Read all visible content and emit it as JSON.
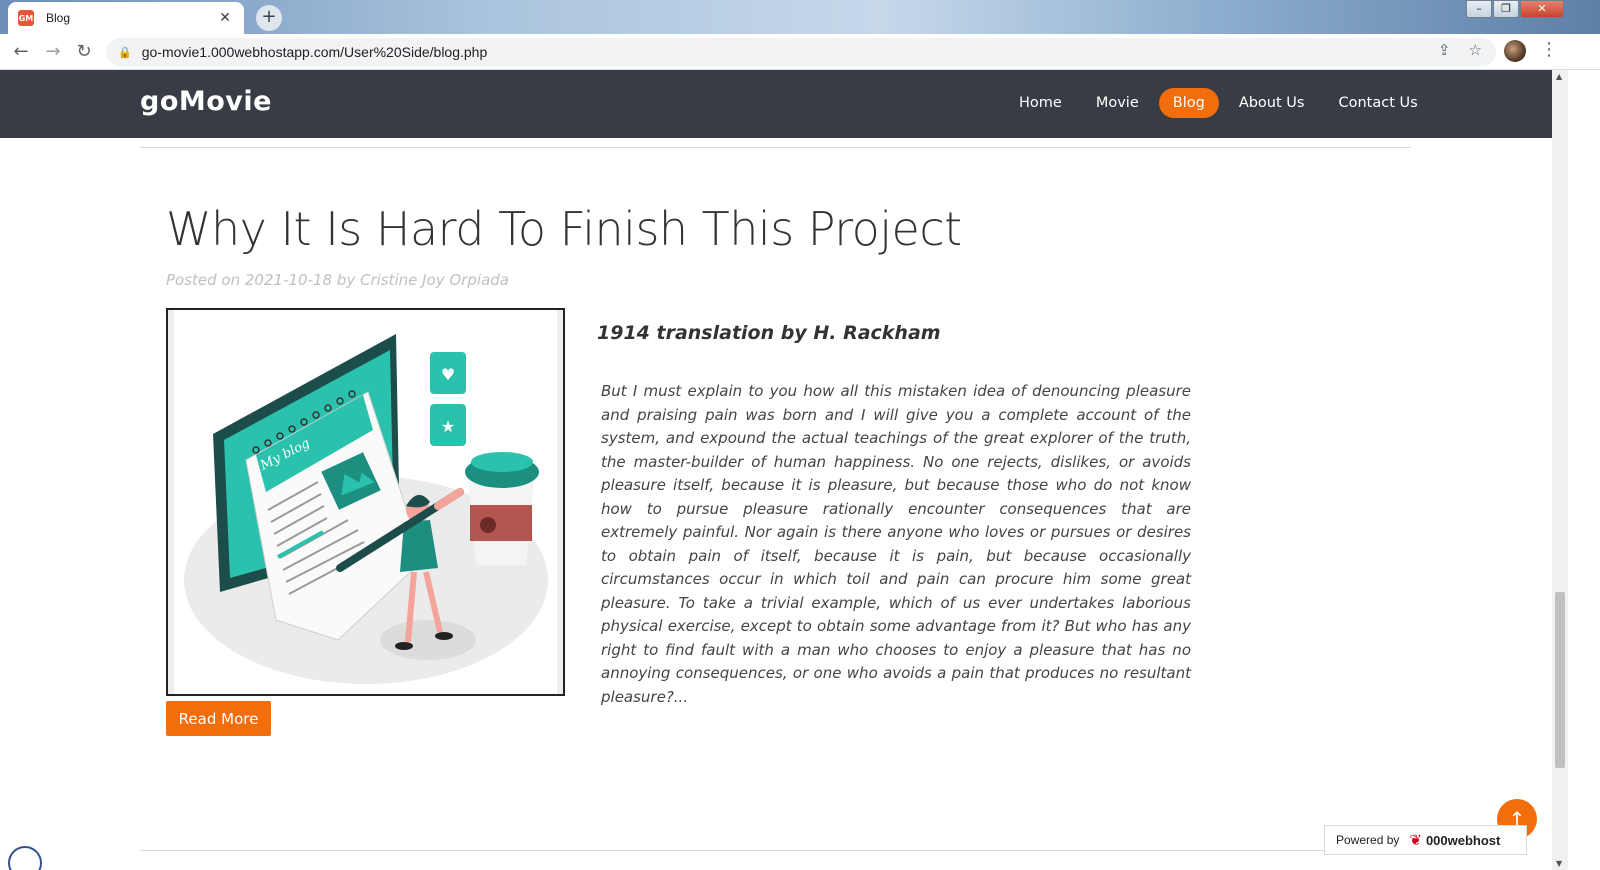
{
  "browser": {
    "tab_title": "Blog",
    "tab_favicon_text": "GM",
    "url": "go-movie1.000webhostapp.com/User%20Side/blog.php",
    "icons": [
      "back-icon",
      "forward-icon",
      "reload-icon",
      "lock-icon",
      "share-icon",
      "star-icon",
      "menu-icon"
    ]
  },
  "site": {
    "brand": "goMovie",
    "nav": [
      {
        "label": "Home"
      },
      {
        "label": "Movie"
      },
      {
        "label": "Blog",
        "active": true
      },
      {
        "label": "About Us"
      },
      {
        "label": "Contact Us"
      }
    ],
    "accent_color": "#f26d0b",
    "header_color": "#383c45"
  },
  "post": {
    "title": "Why It Is Hard To Finish This Project",
    "meta": "Posted on 2021-10-18 by Cristine Joy Orpiada",
    "image_text": "My blog",
    "subtitle": "1914 translation by H. Rackham",
    "excerpt": "But I must explain to you how all this mistaken idea of denouncing pleasure and praising pain was born and I will give you a complete account of the system, and expound the actual teachings of the great explorer of the truth, the master-builder of human happiness. No one rejects, dislikes, or avoids pleasure itself, because it is pleasure, but because those who do not know how to pursue pleasure rationally encounter consequences that are extremely painful. Nor again is there anyone who loves or pursues or desires to obtain pain of itself, because it is pain, but because occasionally circumstances occur in which toil and pain can procure him some great pleasure. To take a trivial example, which of us ever undertakes laborious physical exercise, except to obtain some advantage from it? But who has any right to find fault with a man who chooses to enjoy a pleasure that has no annoying consequences, or one who avoids a pain that produces no resultant pleasure?...",
    "read_more": "Read More"
  },
  "footer": {
    "powered_label": "Powered by",
    "powered_brand": "000webhost"
  }
}
